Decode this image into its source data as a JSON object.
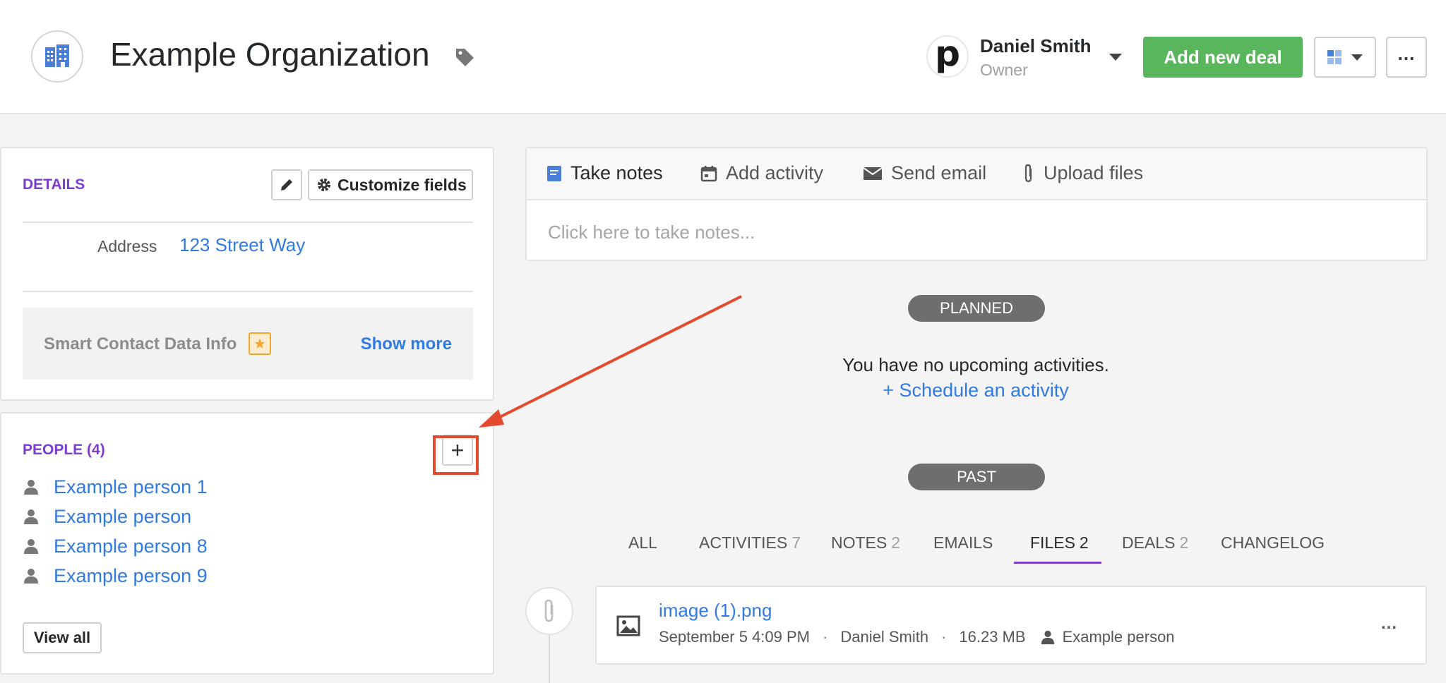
{
  "header": {
    "org_name": "Example Organization",
    "owner_logo_letter": "p",
    "owner_name": "Daniel Smith",
    "owner_role": "Owner",
    "add_deal_label": "Add new deal",
    "more_label": "...",
    "icons": [
      "building-icon",
      "tag-icon",
      "chevron-down-icon",
      "view-grid-icon",
      "more-icon"
    ]
  },
  "details": {
    "title": "DETAILS",
    "customize_label": "Customize fields",
    "address_label": "Address",
    "address_value": "123 Street Way",
    "smart_label": "Smart Contact Data Info",
    "show_more": "Show more"
  },
  "people": {
    "title": "PEOPLE (4)",
    "add_label": "+",
    "items": [
      {
        "name": "Example person 1"
      },
      {
        "name": "Example person"
      },
      {
        "name": "Example person 8"
      },
      {
        "name": "Example person 9"
      }
    ],
    "view_all": "View all"
  },
  "notes": {
    "tabs": [
      {
        "label": "Take notes",
        "icon": "note-icon"
      },
      {
        "label": "Add activity",
        "icon": "calendar-icon"
      },
      {
        "label": "Send email",
        "icon": "envelope-icon"
      },
      {
        "label": "Upload files",
        "icon": "paperclip-icon"
      }
    ],
    "placeholder": "Click here to take notes..."
  },
  "activity": {
    "planned_label": "PLANNED",
    "no_upcoming": "You have no upcoming activities.",
    "schedule_link": "+ Schedule an activity",
    "past_label": "PAST"
  },
  "feed_tabs": [
    {
      "label": "ALL",
      "count": ""
    },
    {
      "label": "ACTIVITIES",
      "count": "7"
    },
    {
      "label": "NOTES",
      "count": "2"
    },
    {
      "label": "EMAILS",
      "count": ""
    },
    {
      "label": "FILES",
      "count": "2"
    },
    {
      "label": "DEALS",
      "count": "2"
    },
    {
      "label": "CHANGELOG",
      "count": ""
    }
  ],
  "file_item": {
    "name": "image (1).png",
    "date": "September 5 4:09 PM",
    "author": "Daniel Smith",
    "size": "16.23 MB",
    "person": "Example person",
    "more": "..."
  },
  "colors": {
    "accent_purple": "#7e3bd0",
    "link_blue": "#317ae2",
    "green_button": "#5ab65c",
    "annotation_red": "#e34a2f"
  }
}
